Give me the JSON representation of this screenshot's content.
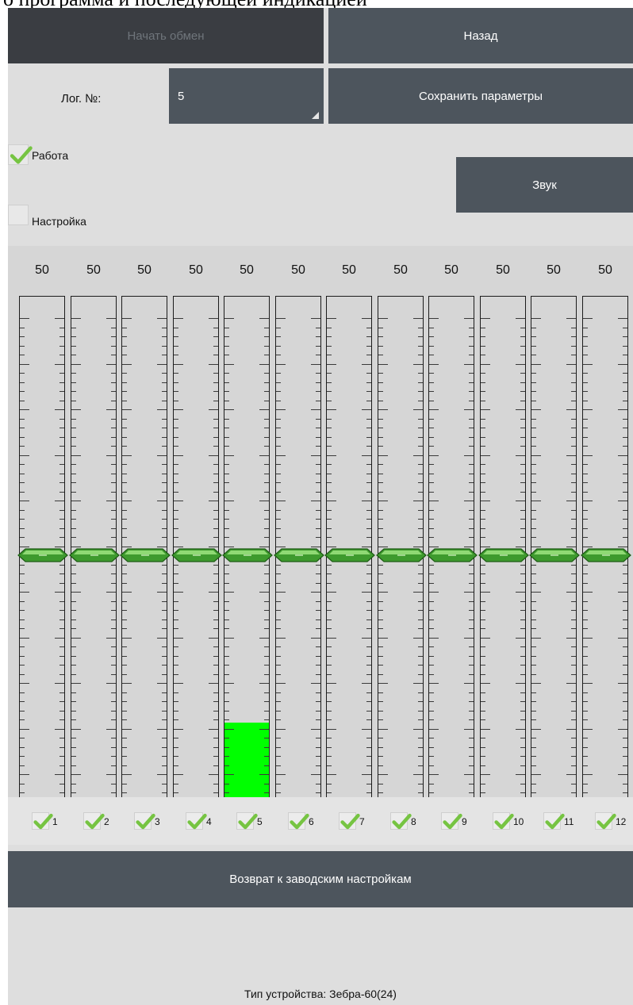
{
  "top_fragment": "о программа и последующей индикацией",
  "buttons": {
    "start_exchange": "Начать обмен",
    "back": "Назад",
    "save_params": "Сохранить параметры",
    "sound": "Звук",
    "factory_reset": "Возврат к заводским настройкам"
  },
  "log": {
    "label": "Лог. №:",
    "value": "5"
  },
  "modes": {
    "work": {
      "label": "Работа",
      "checked": true
    },
    "setup": {
      "label": "Настройка",
      "checked": false
    }
  },
  "channels": [
    {
      "number": "1",
      "value": "50",
      "level_percent": 0,
      "enabled": true
    },
    {
      "number": "2",
      "value": "50",
      "level_percent": 0,
      "enabled": true
    },
    {
      "number": "3",
      "value": "50",
      "level_percent": 0,
      "enabled": true
    },
    {
      "number": "4",
      "value": "50",
      "level_percent": 0,
      "enabled": true
    },
    {
      "number": "5",
      "value": "50",
      "level_percent": 15,
      "enabled": true
    },
    {
      "number": "6",
      "value": "50",
      "level_percent": 0,
      "enabled": true
    },
    {
      "number": "7",
      "value": "50",
      "level_percent": 0,
      "enabled": true
    },
    {
      "number": "8",
      "value": "50",
      "level_percent": 0,
      "enabled": true
    },
    {
      "number": "9",
      "value": "50",
      "level_percent": 0,
      "enabled": true
    },
    {
      "number": "10",
      "value": "50",
      "level_percent": 0,
      "enabled": true
    },
    {
      "number": "11",
      "value": "50",
      "level_percent": 0,
      "enabled": true
    },
    {
      "number": "12",
      "value": "50",
      "level_percent": 0,
      "enabled": true
    }
  ],
  "slider_position_fraction": 0.5,
  "colors": {
    "accent_green": "#76c442",
    "level_green": "#00ff00",
    "button_slate": "#4d555d",
    "button_dark": "#3a3d42"
  },
  "footer": {
    "device_type": "Тип устройства: Зебра-60(24)"
  }
}
